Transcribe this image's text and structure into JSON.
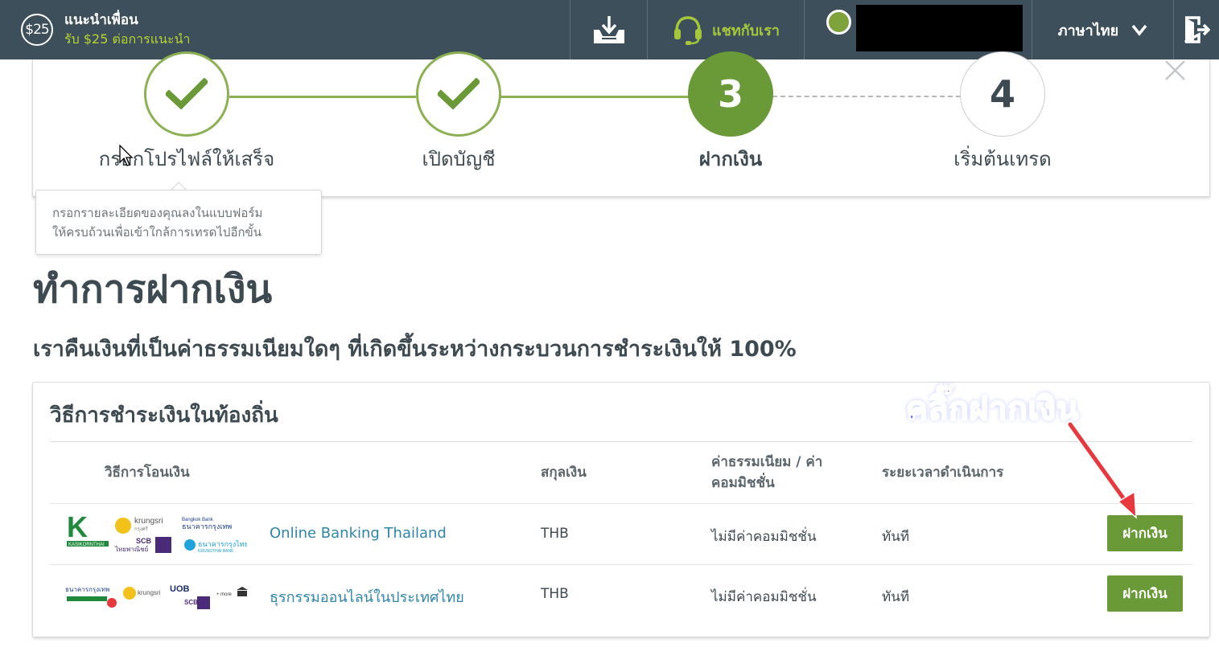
{
  "topbar": {
    "refer_badge": "$25",
    "refer_title": "แนะนำเพื่อน",
    "refer_subtitle": "รับ $25 ต่อการแนะนำ",
    "chat_label": "แชทกับเรา",
    "language_label": "ภาษาไทย",
    "icons": [
      "download-icon",
      "headset-icon",
      "chevron-down-icon",
      "logout-icon"
    ]
  },
  "steps": {
    "items": [
      {
        "label": "กรอกโปรไฟล์ให้เสร็จ",
        "state": "done"
      },
      {
        "label": "เปิดบัญชี",
        "state": "done"
      },
      {
        "label": "ฝากเงิน",
        "state": "active",
        "number": "3"
      },
      {
        "label": "เริ่มต้นเทรด",
        "state": "todo",
        "number": "4"
      }
    ],
    "tooltip_line1": "กรอกรายละเอียดของคุณลงในแบบฟอร์ม",
    "tooltip_line2": "ให้ครบถ้วนเพื่อเข้าใกล้การเทรดไปอีกขั้น"
  },
  "page": {
    "title": "ทำการฝากเงิน",
    "subtitle": "เราคืนเงินที่เป็นค่าธรรมเนียมใดๆ ที่เกิดขึ้นระหว่างกระบวนการชำระเงินให้ 100%"
  },
  "payment": {
    "section_title": "วิธีการชำระเงินในท้องถิ่น",
    "columns": {
      "method": "วิธีการโอนเงิน",
      "currency": "สกุลเงิน",
      "fee_line1": "ค่าธรรมเนียม / ค่า",
      "fee_line2": "คอมมิชชั่น",
      "time": "ระยะเวลาดำเนินการ"
    },
    "rows": [
      {
        "name": "Online Banking Thailand",
        "currency": "THB",
        "fee": "ไม่มีค่าคอมมิชชั่น",
        "time": "ทันที",
        "button": "ฝากเงิน",
        "logos": {
          "k": "K",
          "kbank": "KASIKORNTHAI",
          "krungsri": "krungsri",
          "krungsri_th": "กรุงศรี",
          "bbl_en": "Bangkok Bank",
          "bbl_th": "ธนาคารกรุงเทพ",
          "scb": "SCB",
          "scb_th": "ไทยพาณิชย์",
          "ktb_th": "ธนาคารกรุงไทย",
          "ktb_en": "KRUNGTHAI BANK"
        }
      },
      {
        "name": "ธุรกรรมออนไลน์ในประเทศไทย",
        "currency": "THB",
        "fee": "ไม่มีค่าคอมมิชชั่น",
        "time": "ทันที",
        "button": "ฝากเงิน",
        "logos": {
          "bbl_th": "ธนาคารกรุงเทพ",
          "krungsri": "krungsri",
          "uob": "UOB",
          "scb": "SCB",
          "more": "+ more"
        }
      }
    ]
  },
  "annotation": {
    "text": "คลิ๊กฝากเงิน",
    "color": "#2f3fe0",
    "arrow_color": "#e8383d"
  },
  "colors": {
    "topbar": "#3d4f5a",
    "accent_green": "#6a9a37",
    "link_blue": "#2f86a8",
    "lime": "#b7d332"
  }
}
